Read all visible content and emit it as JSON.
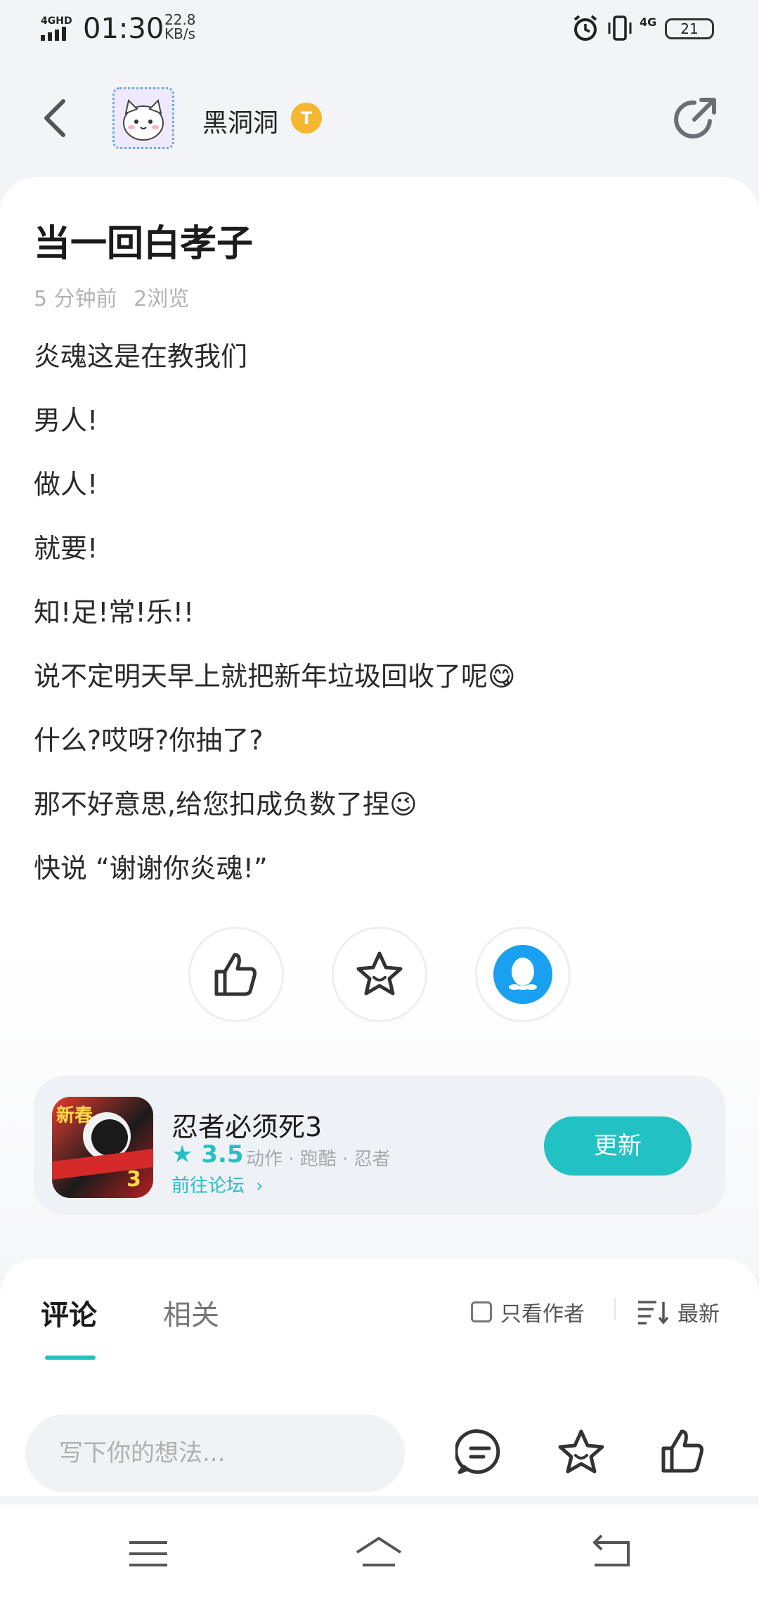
{
  "status_bar": {
    "network": "4GHD",
    "time": "01:30",
    "speed_value": "22.8",
    "speed_unit": "KB/s",
    "network_right": "4G",
    "battery": "21"
  },
  "header": {
    "author_name": "黑洞洞",
    "badge_letter": "T"
  },
  "post": {
    "title": "当一回白孝子",
    "time_ago": "5 分钟前",
    "views": "2浏览",
    "lines": [
      "炎魂这是在教我们",
      "男人!",
      "做人!",
      "就要!",
      "知!足!常!乐!!",
      "说不定明天早上就把新年垃圾回收了呢😋",
      "什么?哎呀?你抽了?",
      "那不好意思,给您扣成负数了捏😉",
      "快说 “谢谢你炎魂!”"
    ]
  },
  "game": {
    "name": "忍者必须死3",
    "rating": "3.5",
    "tags": "动作 · 跑酷 · 忍者",
    "forum_link": "前往论坛",
    "update_label": "更新",
    "icon_text": "新春",
    "icon_num": "3"
  },
  "comments": {
    "tab_comments": "评论",
    "tab_related": "相关",
    "only_author": "只看作者",
    "sort_label": "最新"
  },
  "input": {
    "placeholder": "写下你的想法..."
  },
  "colors": {
    "accent": "#22c1c3",
    "badge": "#f5b630",
    "qq_blue": "#1aa0f0"
  }
}
